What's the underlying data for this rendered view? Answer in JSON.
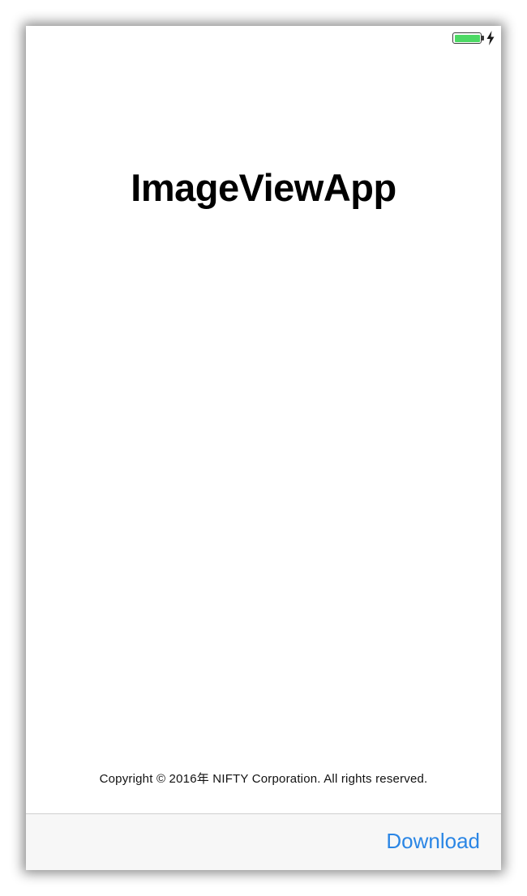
{
  "status_bar": {
    "battery_icon": "battery-full-icon",
    "charging_icon": "lightning-bolt-icon",
    "battery_color": "#4cd964"
  },
  "main": {
    "title": "ImageViewApp",
    "copyright": "Copyright © 2016年 NIFTY Corporation. All rights reserved."
  },
  "toolbar": {
    "download_label": "Download",
    "accent_color": "#2b86e5"
  }
}
